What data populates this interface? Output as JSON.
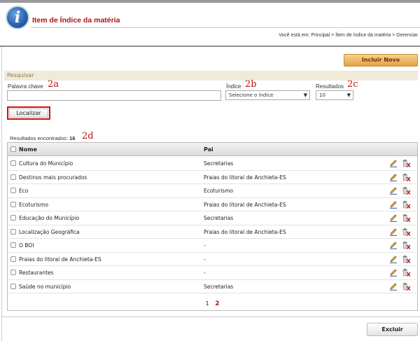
{
  "header": {
    "title": "Item de Índice da matéria",
    "breadcrumb_prefix": "Você está em:",
    "breadcrumb": [
      "Principal",
      "Ítem de índice da matéria",
      "Gerenciar"
    ],
    "breadcrumb_separator": ">"
  },
  "toolbar": {
    "new_label": "Incluir Novo"
  },
  "search": {
    "section_title": "Pesquisar",
    "keyword_label": "Palavra chave",
    "keyword_value": "",
    "index_label": "Índice",
    "index_selected": "Selecione o índice",
    "results_label": "Resultados",
    "results_selected": "10",
    "submit_label": "Localizar"
  },
  "annotations": {
    "keyword": "2a",
    "index": "2b",
    "results": "2c",
    "count": "2d"
  },
  "results": {
    "count_label": "Resultados encontrados:",
    "count_value": "16",
    "columns": [
      "Nome",
      "Pai"
    ],
    "rows": [
      {
        "nome": "Cultura do Município",
        "pai": "Secretarias"
      },
      {
        "nome": "Destinos mais procurados",
        "pai": "Praias do litoral de Anchieta-ES"
      },
      {
        "nome": "Eco",
        "pai": "Ecoturismo"
      },
      {
        "nome": "Ecoturismo",
        "pai": "Praias do litoral de Anchieta-ES"
      },
      {
        "nome": "Educação do Município",
        "pai": "Secretarias"
      },
      {
        "nome": "Localização Geográfica",
        "pai": "Praias do litoral de Anchieta-ES"
      },
      {
        "nome": "O BOI",
        "pai": "-"
      },
      {
        "nome": "Praias do litoral de Anchieta-ES",
        "pai": "-"
      },
      {
        "nome": "Restaurantes",
        "pai": "-"
      },
      {
        "nome": "Saúde no município",
        "pai": "Secretarias"
      }
    ],
    "pages": [
      "1",
      "2"
    ],
    "current_page": "2"
  },
  "footer": {
    "delete_label": "Excluir"
  },
  "icons": {
    "edit": "pencil-edit-icon",
    "delete": "trash-delete-icon"
  },
  "colors": {
    "title": "#b31313",
    "accent_button": "#e3a346",
    "annotation": "#c01010"
  }
}
